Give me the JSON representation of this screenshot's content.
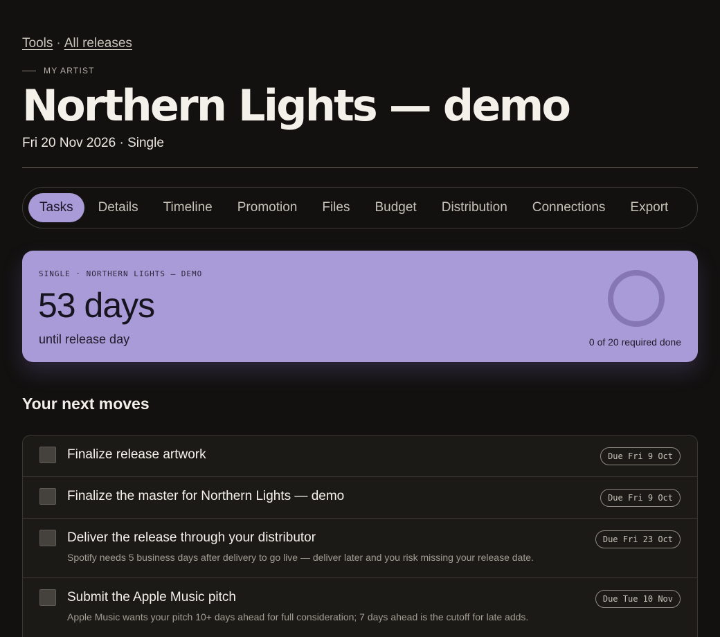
{
  "breadcrumb": {
    "tools": "Tools",
    "separator": "·",
    "all_releases": "All releases"
  },
  "artist_label": "MY ARTIST",
  "release": {
    "title": "Northern Lights — demo",
    "subtitle": "Fri 20 Nov 2026 · Single"
  },
  "tabs": [
    {
      "label": "Tasks",
      "active": true
    },
    {
      "label": "Details"
    },
    {
      "label": "Timeline"
    },
    {
      "label": "Promotion"
    },
    {
      "label": "Files"
    },
    {
      "label": "Budget"
    },
    {
      "label": "Distribution"
    },
    {
      "label": "Connections"
    },
    {
      "label": "Export"
    }
  ],
  "countdown": {
    "eyebrow": "SINGLE · NORTHERN LIGHTS — DEMO",
    "days": "53 days",
    "label": "until release day",
    "progress_text": "0 of 20 required done",
    "progress_fraction": 0,
    "accent_color": "#a99ad8"
  },
  "next_moves": {
    "title": "Your next moves",
    "tasks": [
      {
        "title": "Finalize release artwork",
        "due": "Due Fri 9 Oct"
      },
      {
        "title": "Finalize the master for Northern Lights — demo",
        "due": "Due Fri 9 Oct"
      },
      {
        "title": "Deliver the release through your distributor",
        "desc": "Spotify needs 5 business days after delivery to go live — deliver later and you risk missing your release date.",
        "due": "Due Fri 23 Oct"
      },
      {
        "title": "Submit the Apple Music pitch",
        "desc": "Apple Music wants your pitch 10+ days ahead for full consideration; 7 days ahead is the cutoff for late adds.",
        "due": "Due Tue 10 Nov"
      }
    ]
  }
}
